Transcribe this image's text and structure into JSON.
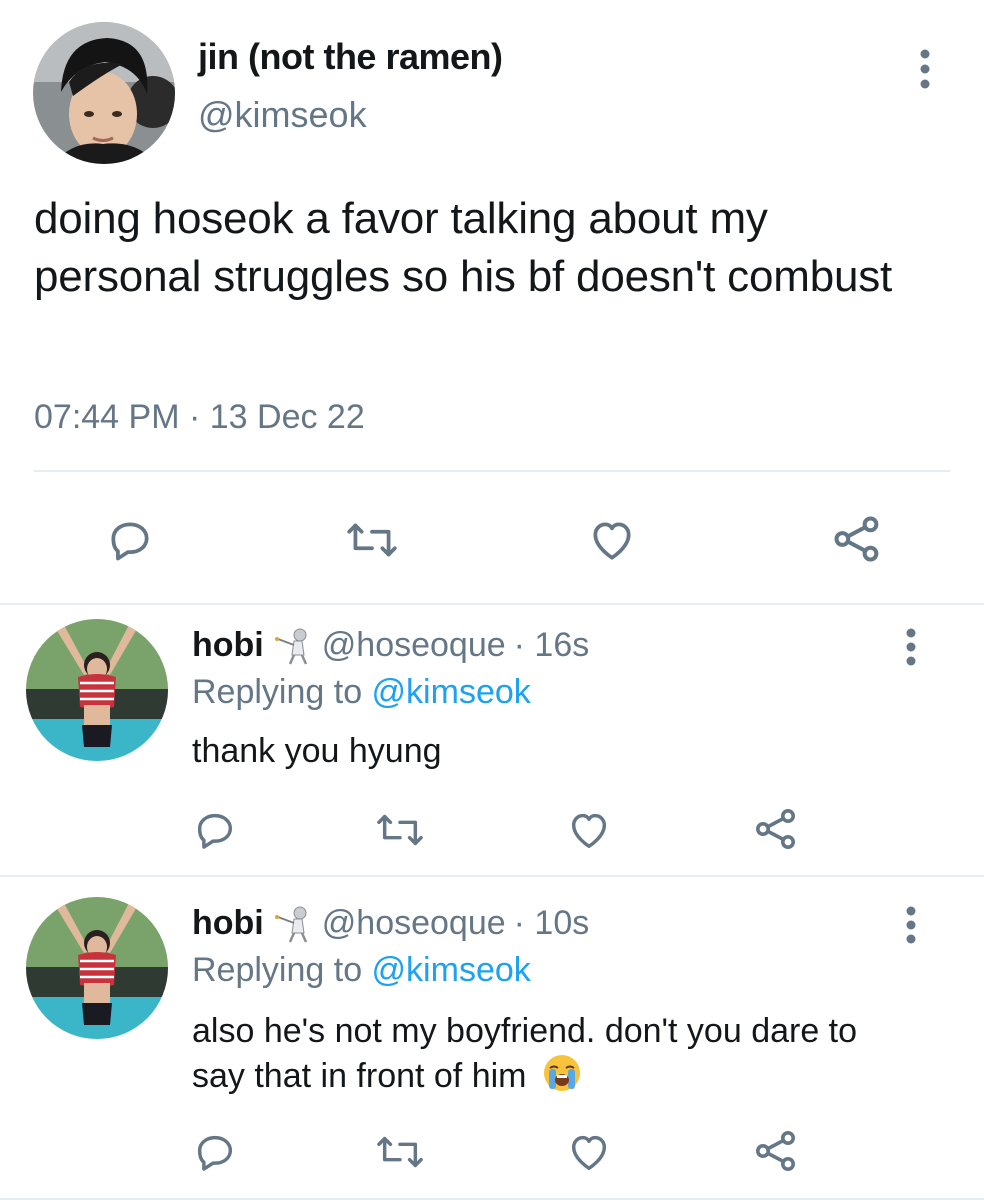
{
  "main_tweet": {
    "display_name": "jin (not the ramen)",
    "handle": "@kimseok",
    "text": "doing hoseok a favor talking about my personal struggles so his bf doesn't combust",
    "timestamp": "07:44 PM · 13 Dec 22"
  },
  "replies": [
    {
      "display_name": "hobi",
      "handle": "@hoseoque",
      "age": "· 16s",
      "replying_prefix": "Replying to ",
      "replying_to": "@kimseok",
      "text": "thank you hyung",
      "emoji": "fencer-emoji"
    },
    {
      "display_name": "hobi",
      "handle": "@hoseoque",
      "age": "· 10s",
      "replying_prefix": "Replying to ",
      "replying_to": "@kimseok",
      "text": "also he's not my boyfriend. don't you dare to say that in front of him",
      "emoji": "fencer-emoji",
      "trailing_emoji": "loudly-crying-face-emoji"
    }
  ],
  "icons": {
    "reply": "reply-icon",
    "retweet": "retweet-icon",
    "like": "heart-icon",
    "share": "share-icon",
    "more": "more-vertical-icon"
  },
  "colors": {
    "text": "#14171a",
    "secondary": "#657786",
    "link": "#1da1f2",
    "divider": "#e6ecf0"
  }
}
